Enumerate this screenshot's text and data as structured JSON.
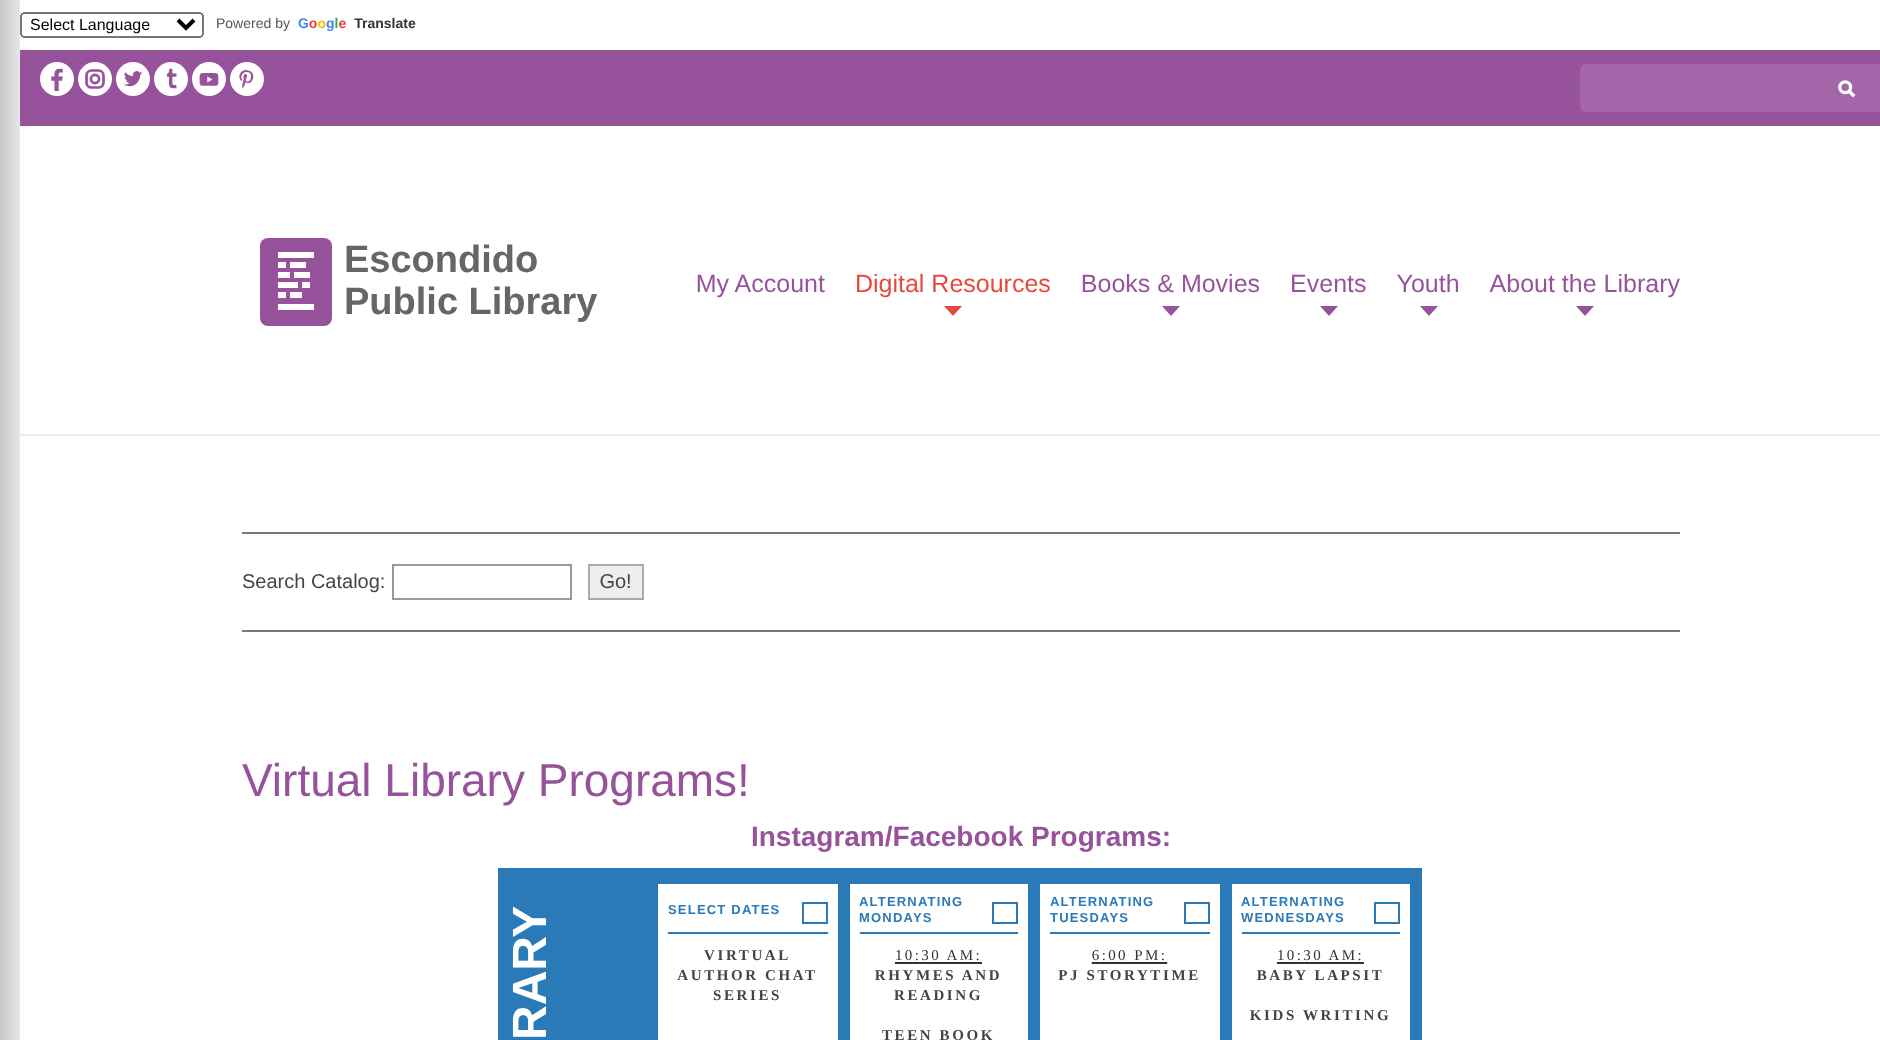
{
  "translate_bar": {
    "language_select": "Select Language",
    "powered_by": "Powered by",
    "google": "Google",
    "translate": "Translate"
  },
  "social_bar": {
    "icons": [
      {
        "kind": "facebook"
      },
      {
        "kind": "instagram"
      },
      {
        "kind": "twitter"
      },
      {
        "kind": "tumblr"
      },
      {
        "kind": "youtube"
      },
      {
        "kind": "pinterest"
      }
    ]
  },
  "header": {
    "logo_line_1": "Escondido",
    "logo_line_2": "Public Library",
    "nav": [
      {
        "label": "My Account",
        "selected": false,
        "dropdown": false
      },
      {
        "label": "Digital Resources",
        "selected": true,
        "dropdown": true
      },
      {
        "label": "Books & Movies",
        "selected": false,
        "dropdown": true
      },
      {
        "label": "Events",
        "selected": false,
        "dropdown": true
      },
      {
        "label": "Youth",
        "selected": false,
        "dropdown": true
      },
      {
        "label": "About the Library",
        "selected": false,
        "dropdown": true
      }
    ]
  },
  "catalog_search": {
    "label": "Search Catalog:",
    "button": "Go!"
  },
  "page_title": "Virtual Library Programs!",
  "section_title": "Instagram/Facebook Programs:",
  "flyer": {
    "side_text": "RARY",
    "cards": [
      {
        "header": "SELECT DATES",
        "checked": false,
        "entries": [
          {
            "text": "VIRTUAL AUTHOR CHAT SERIES"
          }
        ]
      },
      {
        "header": "ALTERNATING MONDAYS",
        "checked": false,
        "entries": [
          {
            "time": "10:30 AM:",
            "text": "RHYMES AND READING"
          },
          {
            "text": "TEEN BOOK"
          }
        ]
      },
      {
        "header": "ALTERNATING TUESDAYS",
        "checked": false,
        "entries": [
          {
            "time": "6:00 PM:",
            "text": "PJ STORYTIME"
          }
        ]
      },
      {
        "header": "ALTERNATING WEDNESDAYS",
        "checked": false,
        "entries": [
          {
            "time": "10:30 AM:",
            "text": "BABY LAPSIT"
          },
          {
            "text": "KIDS WRITING"
          }
        ]
      }
    ]
  }
}
